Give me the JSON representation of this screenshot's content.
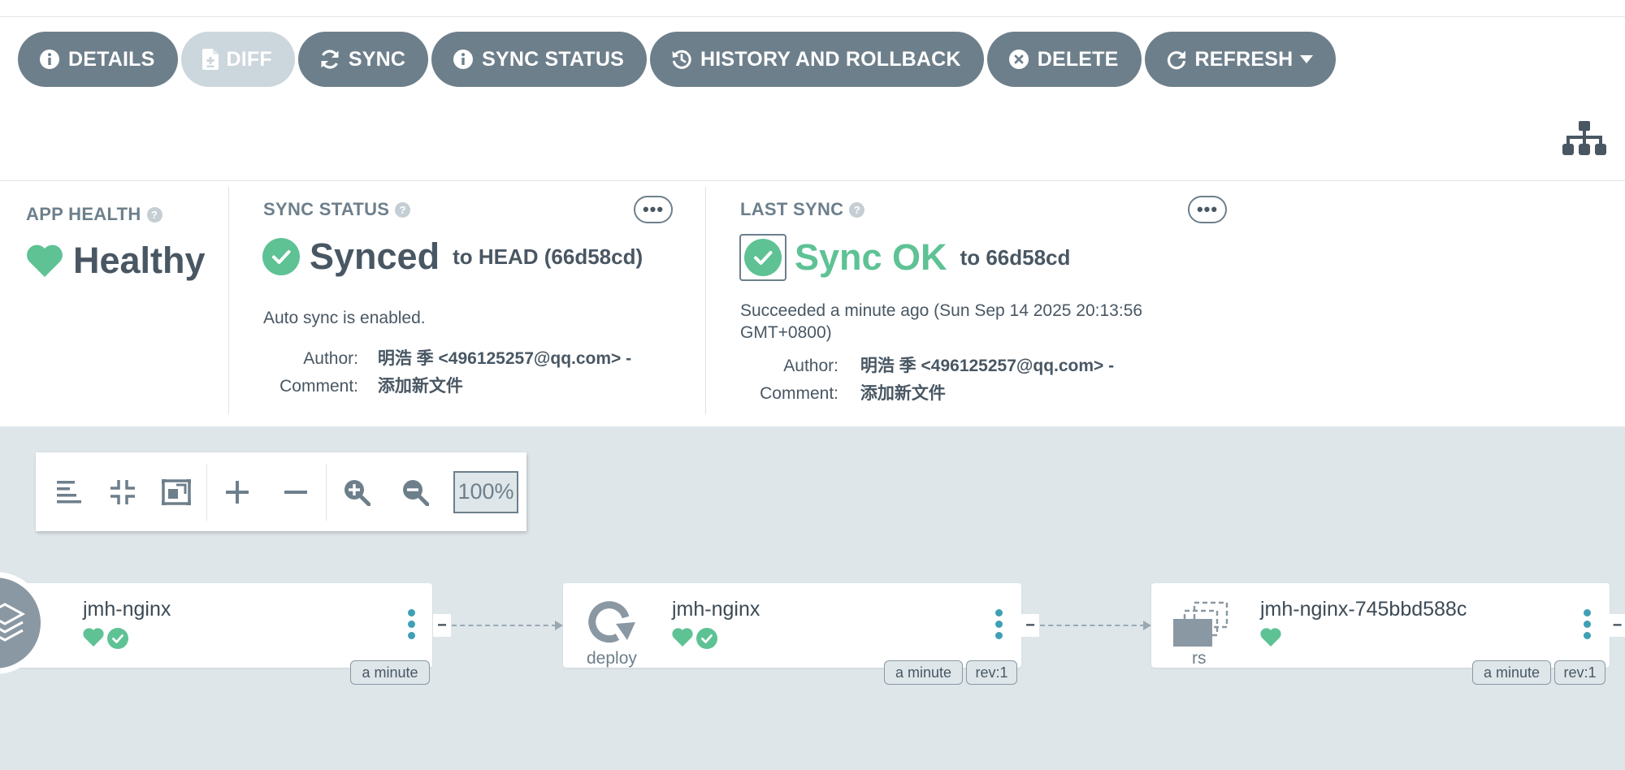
{
  "toolbar": {
    "details": "DETAILS",
    "diff": "DIFF",
    "sync": "SYNC",
    "sync_status": "SYNC STATUS",
    "history": "HISTORY AND ROLLBACK",
    "delete": "DELETE",
    "refresh": "REFRESH"
  },
  "app_health": {
    "label": "APP HEALTH",
    "status": "Healthy",
    "color": "#5ec294"
  },
  "sync_status": {
    "label": "SYNC STATUS",
    "status": "Synced",
    "target": "to HEAD (66d58cd)",
    "auto_sync": "Auto sync is enabled.",
    "author_label": "Author:",
    "author": "明浩 季 <496125257@qq.com> -",
    "comment_label": "Comment:",
    "comment": "添加新文件"
  },
  "last_sync": {
    "label": "LAST SYNC",
    "status": "Sync OK",
    "target": "to 66d58cd",
    "time_line1": "Succeeded a minute ago (Sun Sep 14 2025 20:13:56",
    "time_line2": "GMT+0800)",
    "author_label": "Author:",
    "author": "明浩 季 <496125257@qq.com> -",
    "comment_label": "Comment:",
    "comment": "添加新文件",
    "color": "#5ec294"
  },
  "zoom": {
    "value": "100%"
  },
  "nodes": [
    {
      "name": "jmh-nginx",
      "kind": "",
      "age": "a minute",
      "rev": ""
    },
    {
      "name": "jmh-nginx",
      "kind": "deploy",
      "age": "a minute",
      "rev": "rev:1"
    },
    {
      "name": "jmh-nginx-745bbd588c",
      "kind": "rs",
      "age": "a minute",
      "rev": "rev:1"
    }
  ],
  "colors": {
    "button_bg": "#6d7f8b",
    "button_disabled_bg": "#ccd6dd",
    "healthy": "#5ec294",
    "canvas_bg": "#dee6ea",
    "kebab": "#3f9fb5"
  }
}
